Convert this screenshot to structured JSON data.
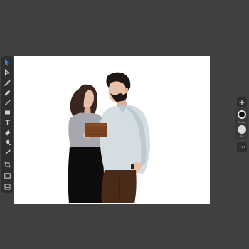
{
  "app": {
    "background_color": "#404040",
    "canvas_color": "#ffffff",
    "accent_color": "#2f8ae8"
  },
  "left_toolbar": {
    "tools": [
      {
        "name": "select-tool",
        "icon": "arrow-pointer-icon",
        "active": true
      },
      {
        "name": "direct-select-tool",
        "icon": "hollow-arrow-icon"
      },
      {
        "name": "pen-tool",
        "icon": "pen-nib-icon"
      },
      {
        "name": "pencil-tool",
        "icon": "pencil-icon"
      },
      {
        "name": "brush-tool",
        "icon": "brush-icon"
      },
      {
        "name": "shape-tool",
        "icon": "rectangle-icon"
      },
      {
        "name": "text-tool",
        "icon": "text-t-icon"
      },
      {
        "name": "eraser-tool",
        "icon": "eraser-icon"
      },
      {
        "name": "fill-tool",
        "icon": "paint-bucket-icon"
      },
      {
        "name": "eyedropper-tool",
        "icon": "eyedropper-icon"
      },
      {
        "name": "crop-tool",
        "icon": "crop-icon"
      },
      {
        "name": "image-tool",
        "icon": "image-frame-icon"
      },
      {
        "name": "layers-tool",
        "icon": "layers-icon"
      }
    ]
  },
  "right_panel": {
    "add_icon": "plus-icon",
    "stroke_label": "Stroke",
    "fill_label": "Fill",
    "stroke_color": "#111111",
    "fill_color": "#d9d9d9",
    "more_icon": "ellipsis-icon"
  },
  "artwork": {
    "description_colors": {
      "skin": "#e8c2a8",
      "woman_hair": "#3b2520",
      "woman_top": "#a6a8ad",
      "woman_skirt": "#0c0c0c",
      "man_hair": "#1e1714",
      "man_shirt": "#d4dde1",
      "man_pants": "#4a2b1a",
      "box": "#7a4420"
    }
  }
}
